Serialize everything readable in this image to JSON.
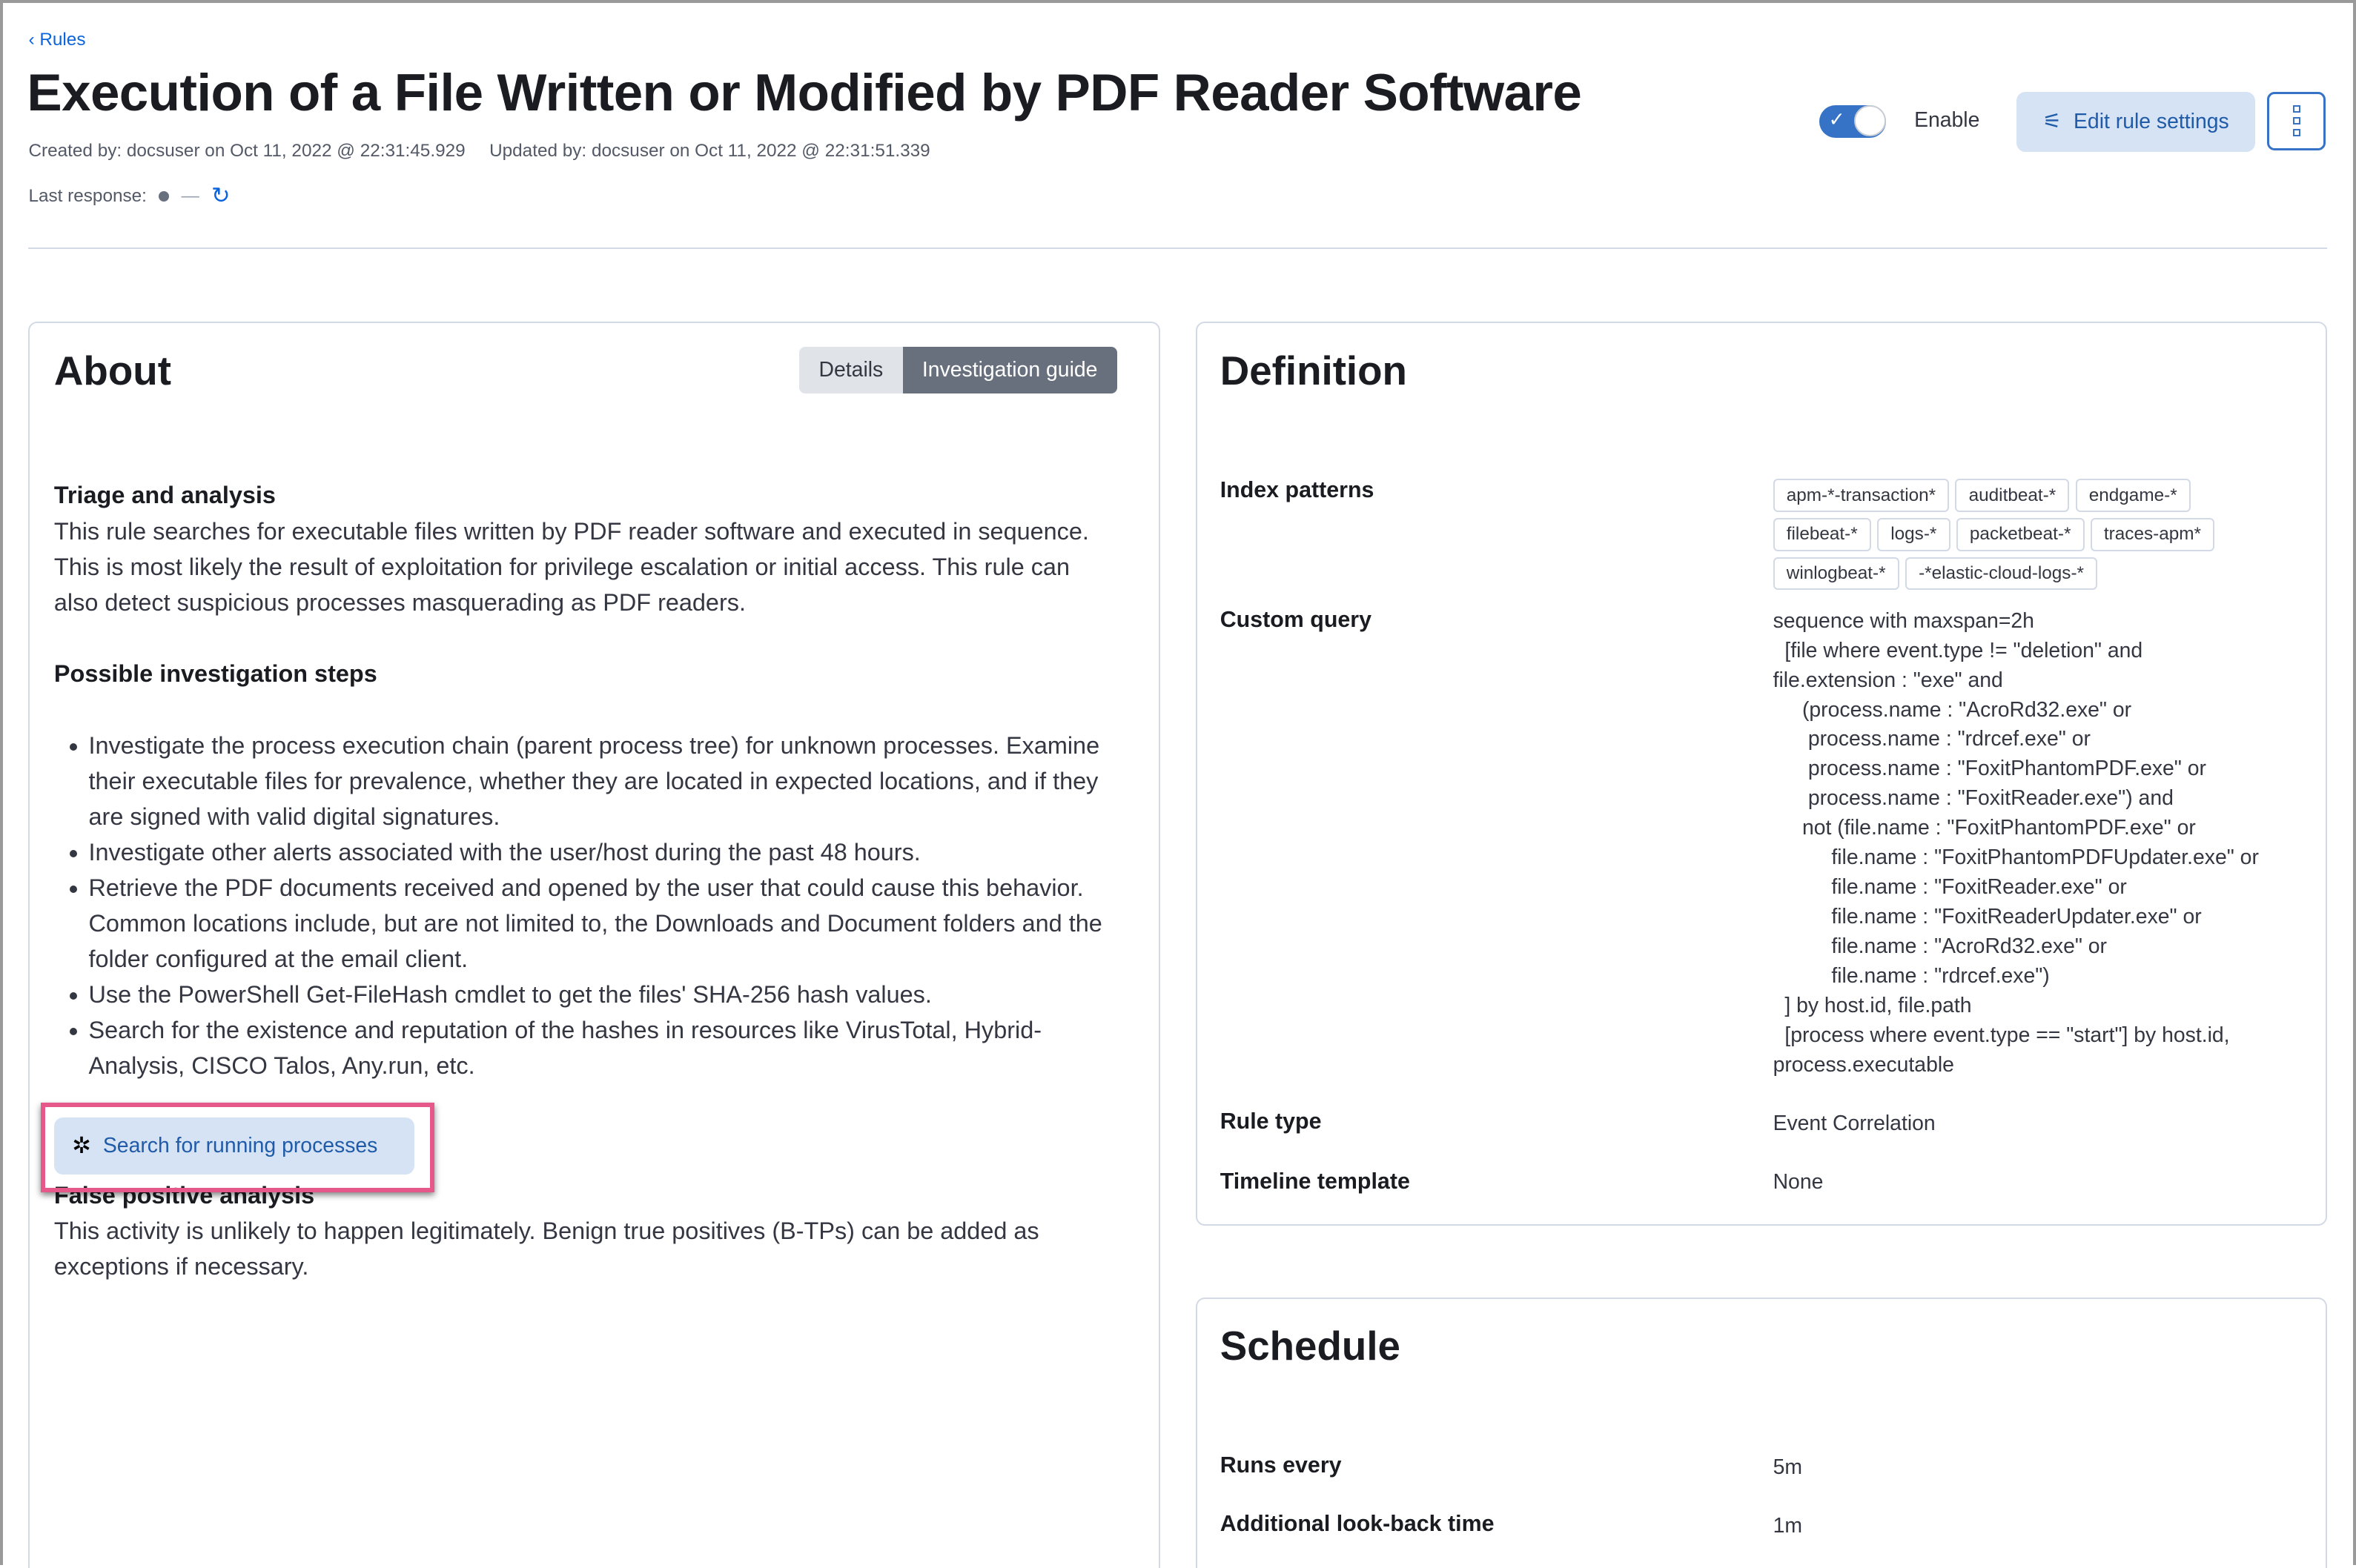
{
  "header": {
    "back_label": "Rules",
    "title": "Execution of a File Written or Modified by PDF Reader Software",
    "created": "Created by: docsuser on Oct 11, 2022 @ 22:31:45.929",
    "updated": "Updated by: docsuser on Oct 11, 2022 @ 22:31:51.339",
    "last_response_label": "Last response:",
    "last_response_value": "—",
    "enable_label": "Enable",
    "enabled": true,
    "edit_label": "Edit rule settings"
  },
  "about": {
    "title": "About",
    "tabs": [
      {
        "label": "Details",
        "active": false
      },
      {
        "label": "Investigation guide",
        "active": true
      }
    ],
    "triage_heading": "Triage and analysis",
    "triage_text": "This rule searches for executable files written by PDF reader software and executed in sequence. This is most likely the result of exploitation for privilege escalation or initial access. This rule can also detect suspicious processes masquerading as PDF readers.",
    "steps_heading": "Possible investigation steps",
    "steps": [
      "Investigate the process execution chain (parent process tree) for unknown processes. Examine their executable files for prevalence, whether they are located in expected locations, and if they are signed with valid digital signatures.",
      "Investigate other alerts associated with the user/host during the past 48 hours.",
      "Retrieve the PDF documents received and opened by the user that could cause this behavior. Common locations include, but are not limited to, the Downloads and Document folders and the folder configured at the email client.",
      "Use the PowerShell Get-FileHash cmdlet to get the files' SHA-256 hash values.",
      "Search for the existence and reputation of the hashes in resources like VirusTotal, Hybrid-Analysis, CISCO Talos, Any.run, etc."
    ],
    "search_button": "Search for running processes",
    "fp_heading": "False positive analysis",
    "fp_text": "This activity is unlikely to happen legitimately. Benign true positives (B-TPs) can be added as exceptions if necessary."
  },
  "definition": {
    "title": "Definition",
    "index_label": "Index patterns",
    "index_patterns": [
      "apm-*-transaction*",
      "auditbeat-*",
      "endgame-*",
      "filebeat-*",
      "logs-*",
      "packetbeat-*",
      "traces-apm*",
      "winlogbeat-*",
      "-*elastic-cloud-logs-*"
    ],
    "query_label": "Custom query",
    "query_lines": [
      "sequence with maxspan=2h",
      "  [file where event.type != \"deletion\" and",
      "file.extension : \"exe\" and",
      "     (process.name : \"AcroRd32.exe\" or",
      "      process.name : \"rdrcef.exe\" or",
      "      process.name : \"FoxitPhantomPDF.exe\" or",
      "      process.name : \"FoxitReader.exe\") and",
      "     not (file.name : \"FoxitPhantomPDF.exe\" or",
      "          file.name : \"FoxitPhantomPDFUpdater.exe\" or",
      "          file.name : \"FoxitReader.exe\" or",
      "          file.name : \"FoxitReaderUpdater.exe\" or",
      "          file.name : \"AcroRd32.exe\" or",
      "          file.name : \"rdrcef.exe\")",
      "  ] by host.id, file.path",
      "  [process where event.type == \"start\"] by host.id,",
      "process.executable"
    ],
    "rule_type_label": "Rule type",
    "rule_type": "Event Correlation",
    "timeline_label": "Timeline template",
    "timeline": "None"
  },
  "schedule": {
    "title": "Schedule",
    "runs_label": "Runs every",
    "runs": "5m",
    "lookback_label": "Additional look-back time",
    "lookback": "1m"
  }
}
